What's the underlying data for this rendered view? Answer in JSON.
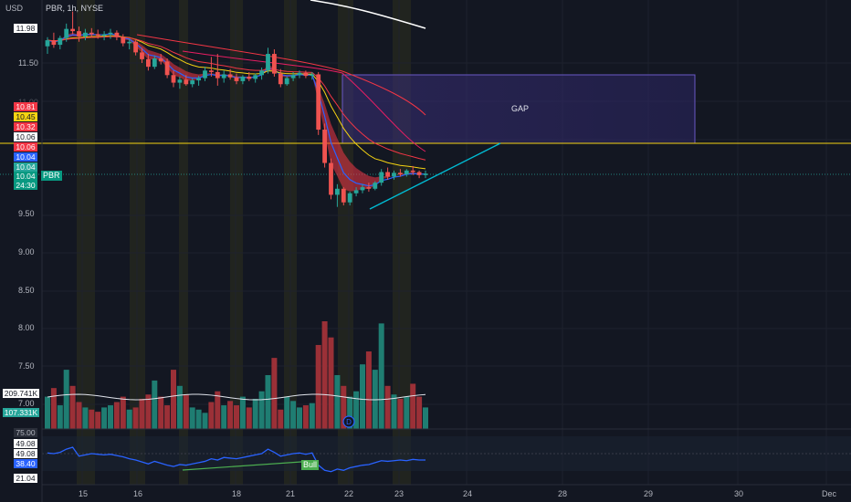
{
  "header": {
    "currency": "USD",
    "ticker_line": "PBR, 1h, NYSE"
  },
  "price_axis": {
    "ticks": [
      "11.50",
      "9.50",
      "9.00",
      "8.50",
      "8.00",
      "7.50",
      "7.00",
      "11.00"
    ],
    "tags": [
      {
        "text": "11.98",
        "bg": "#ffffff",
        "fg": "#131722"
      },
      {
        "text": "10.81",
        "bg": "#f23645",
        "fg": "#ffffff"
      },
      {
        "text": "10.45",
        "bg": "#f5d312",
        "fg": "#131722"
      },
      {
        "text": "10.32",
        "bg": "#f23645",
        "fg": "#ffffff"
      },
      {
        "text": "10.06",
        "bg": "#ffffff",
        "fg": "#131722"
      },
      {
        "text": "10.06",
        "bg": "#f23645",
        "fg": "#ffffff"
      },
      {
        "text": "10.04",
        "bg": "#2962ff",
        "fg": "#ffffff"
      },
      {
        "text": "10.04",
        "bg": "#26a69a",
        "fg": "#ffffff"
      },
      {
        "text": "10.04",
        "bg": "#089981",
        "fg": "#ffffff"
      },
      {
        "text": "24:30",
        "bg": "#089981",
        "fg": "#ffffff"
      }
    ],
    "symbol_badge": "PBR",
    "volume_tags": [
      {
        "text": "209.741K",
        "bg": "#ffffff",
        "fg": "#131722"
      },
      {
        "text": "107.331K",
        "bg": "#26a69a",
        "fg": "#ffffff"
      }
    ]
  },
  "rsi_axis": {
    "tags": [
      {
        "text": "75.00",
        "bg": "#2a2e39",
        "fg": "#b2b5be"
      },
      {
        "text": "49.08",
        "bg": "#ffffff",
        "fg": "#131722"
      },
      {
        "text": "49.08",
        "bg": "#ffffff",
        "fg": "#131722"
      },
      {
        "text": "38.40",
        "bg": "#2962ff",
        "fg": "#ffffff"
      },
      {
        "text": "21.04",
        "bg": "#ffffff",
        "fg": "#131722"
      }
    ],
    "divergence_label": "Bull"
  },
  "time_axis": [
    "15",
    "16",
    "18",
    "21",
    "22",
    "23",
    "24",
    "28",
    "29",
    "30",
    "Dec"
  ],
  "annotations": {
    "gap_label": "GAP"
  },
  "chart_data": {
    "type": "candlestick",
    "symbol": "PBR",
    "interval": "1h",
    "exchange": "NYSE",
    "ylim": [
      7.0,
      12.0
    ],
    "price_levels": {
      "last": 10.04,
      "horizontal_line": 10.06,
      "gap_zone": [
        10.06,
        11.35
      ],
      "ema_values": [
        10.81,
        10.45,
        10.32,
        10.06,
        10.04
      ]
    },
    "candles": [
      [
        11.72,
        11.84,
        11.62,
        11.8
      ],
      [
        11.8,
        11.9,
        11.7,
        11.74
      ],
      [
        11.74,
        11.86,
        11.68,
        11.83
      ],
      [
        11.83,
        12.02,
        11.78,
        11.95
      ],
      [
        11.95,
        12.18,
        11.88,
        11.92
      ],
      [
        11.92,
        11.98,
        11.78,
        11.85
      ],
      [
        11.85,
        11.95,
        11.8,
        11.9
      ],
      [
        11.9,
        11.96,
        11.84,
        11.88
      ],
      [
        11.88,
        11.94,
        11.82,
        11.86
      ],
      [
        11.86,
        11.92,
        11.8,
        11.88
      ],
      [
        11.88,
        11.95,
        11.82,
        11.9
      ],
      [
        11.9,
        11.93,
        11.8,
        11.84
      ],
      [
        11.84,
        11.88,
        11.72,
        11.76
      ],
      [
        11.76,
        11.82,
        11.68,
        11.78
      ],
      [
        11.78,
        11.8,
        11.6,
        11.64
      ],
      [
        11.64,
        11.7,
        11.5,
        11.55
      ],
      [
        11.55,
        11.62,
        11.4,
        11.45
      ],
      [
        11.45,
        11.6,
        11.42,
        11.56
      ],
      [
        11.56,
        11.62,
        11.48,
        11.52
      ],
      [
        11.52,
        11.56,
        11.3,
        11.34
      ],
      [
        11.34,
        11.4,
        11.18,
        11.24
      ],
      [
        11.24,
        11.32,
        11.16,
        11.28
      ],
      [
        11.28,
        11.34,
        11.2,
        11.22
      ],
      [
        11.22,
        11.3,
        11.18,
        11.27
      ],
      [
        11.27,
        11.33,
        11.2,
        11.3
      ],
      [
        11.3,
        11.45,
        11.26,
        11.4
      ],
      [
        11.4,
        11.58,
        11.32,
        11.38
      ],
      [
        11.38,
        11.62,
        11.2,
        11.3
      ],
      [
        11.3,
        11.4,
        11.24,
        11.35
      ],
      [
        11.35,
        11.42,
        11.28,
        11.31
      ],
      [
        11.31,
        11.36,
        11.22,
        11.26
      ],
      [
        11.26,
        11.34,
        11.22,
        11.32
      ],
      [
        11.32,
        11.38,
        11.26,
        11.29
      ],
      [
        11.29,
        11.36,
        11.24,
        11.34
      ],
      [
        11.34,
        11.44,
        11.28,
        11.4
      ],
      [
        11.4,
        11.7,
        11.36,
        11.62
      ],
      [
        11.62,
        11.68,
        11.32,
        11.36
      ],
      [
        11.36,
        11.42,
        11.18,
        11.22
      ],
      [
        11.22,
        11.32,
        11.2,
        11.3
      ],
      [
        11.3,
        11.38,
        11.26,
        11.34
      ],
      [
        11.34,
        11.4,
        11.3,
        11.37
      ],
      [
        11.37,
        11.4,
        11.3,
        11.33
      ],
      [
        11.33,
        11.38,
        11.28,
        11.35
      ],
      [
        11.35,
        11.38,
        10.55,
        10.62
      ],
      [
        10.62,
        10.7,
        10.12,
        10.18
      ],
      [
        10.18,
        10.24,
        9.7,
        9.76
      ],
      [
        9.76,
        9.9,
        9.6,
        9.84
      ],
      [
        9.84,
        9.86,
        9.62,
        9.66
      ],
      [
        9.66,
        9.8,
        9.62,
        9.78
      ],
      [
        9.78,
        9.86,
        9.74,
        9.82
      ],
      [
        9.82,
        9.9,
        9.78,
        9.86
      ],
      [
        9.86,
        9.92,
        9.8,
        9.84
      ],
      [
        9.84,
        9.94,
        9.82,
        9.92
      ],
      [
        9.92,
        10.1,
        9.88,
        10.06
      ],
      [
        10.06,
        10.12,
        9.96,
        10.0
      ],
      [
        10.0,
        10.08,
        9.96,
        10.05
      ],
      [
        10.05,
        10.1,
        10.0,
        10.03
      ],
      [
        10.03,
        10.1,
        10.0,
        10.08
      ],
      [
        10.08,
        10.14,
        10.02,
        10.06
      ],
      [
        10.06,
        10.08,
        9.98,
        10.02
      ],
      [
        10.02,
        10.08,
        9.98,
        10.04
      ]
    ],
    "volume": [
      0.3,
      0.38,
      0.22,
      0.55,
      0.4,
      0.25,
      0.2,
      0.18,
      0.16,
      0.2,
      0.22,
      0.25,
      0.3,
      0.18,
      0.2,
      0.28,
      0.32,
      0.45,
      0.3,
      0.22,
      0.55,
      0.4,
      0.32,
      0.2,
      0.18,
      0.15,
      0.25,
      0.35,
      0.22,
      0.26,
      0.22,
      0.3,
      0.2,
      0.28,
      0.35,
      0.5,
      0.66,
      0.18,
      0.3,
      0.26,
      0.2,
      0.22,
      0.24,
      0.78,
      1.0,
      0.85,
      0.5,
      0.4,
      0.3,
      0.35,
      0.6,
      0.72,
      0.55,
      0.98,
      0.4,
      0.32,
      0.28,
      0.3,
      0.42,
      0.3,
      0.2
    ],
    "rsi": [
      49,
      48,
      50,
      55,
      58,
      44,
      46,
      48,
      47,
      46,
      47,
      45,
      43,
      40,
      38,
      35,
      32,
      36,
      33,
      30,
      28,
      31,
      30,
      32,
      34,
      36,
      40,
      38,
      42,
      41,
      40,
      42,
      44,
      46,
      48,
      55,
      50,
      44,
      46,
      48,
      49,
      47,
      49,
      30,
      22,
      20,
      24,
      22,
      26,
      28,
      30,
      31,
      34,
      37,
      36,
      37,
      38,
      37,
      39,
      38,
      38
    ],
    "rsi_levels": [
      75.0,
      49.08,
      38.4,
      21.04
    ],
    "dates": [
      "15",
      "16",
      "18",
      "21",
      "22",
      "23",
      "24",
      "28",
      "29",
      "30",
      "Dec"
    ]
  }
}
